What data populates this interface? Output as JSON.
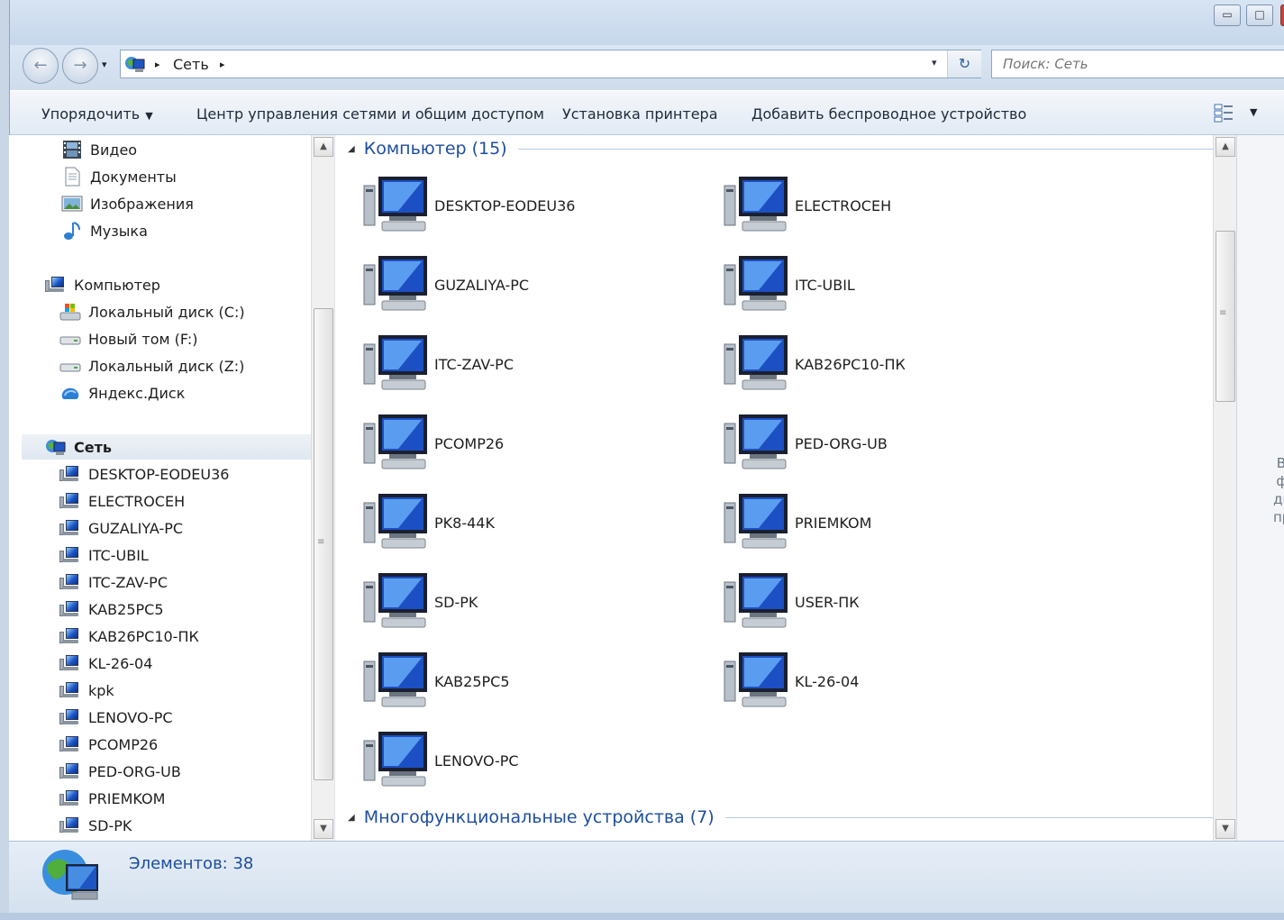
{
  "window": {
    "min_glyph": "▭",
    "max_glyph": "□"
  },
  "address": {
    "back_glyph": "←",
    "forward_glyph": "→",
    "crumb_sep": "▸",
    "crumbs": [
      "Сеть"
    ],
    "dropdown_glyph": "▾",
    "refresh_glyph": "↻"
  },
  "search": {
    "placeholder": "Поиск: Сеть"
  },
  "toolbar": {
    "organize": "Упорядочить",
    "network_center": "Центр управления сетями и общим доступом",
    "add_printer": "Установка принтера",
    "add_wireless": "Добавить беспроводное устройство"
  },
  "nav": {
    "libraries": [
      {
        "label": "Видео",
        "icon": "video-library-icon"
      },
      {
        "label": "Документы",
        "icon": "documents-library-icon"
      },
      {
        "label": "Изображения",
        "icon": "pictures-library-icon"
      },
      {
        "label": "Музыка",
        "icon": "music-library-icon"
      }
    ],
    "computer": {
      "label": "Компьютер"
    },
    "drives": [
      {
        "label": "Локальный диск (C:)",
        "icon": "system-drive-icon"
      },
      {
        "label": "Новый том (F:)",
        "icon": "drive-icon"
      },
      {
        "label": "Локальный диск (Z:)",
        "icon": "drive-icon"
      },
      {
        "label": "Яндекс.Диск",
        "icon": "yandex-disk-icon"
      }
    ],
    "network": {
      "label": "Сеть"
    },
    "hosts": [
      "DESKTOP-EODEU36",
      "ELECTROCEH",
      "GUZALIYA-PC",
      "ITC-UBIL",
      "ITC-ZAV-PC",
      "KAB25PC5",
      "KAB26PC10-ПК",
      "KL-26-04",
      "kpk",
      "LENOVO-PC",
      "PCOMP26",
      "PED-ORG-UB",
      "PRIEMKOM",
      "SD-PK"
    ]
  },
  "content": {
    "group_computers": "Компьютер (15)",
    "group_mfp": "Многофункциональные устройства (7)",
    "computers": [
      "DESKTOP-EODEU36",
      "ELECTROCEH",
      "GUZALIYA-PC",
      "ITC-UBIL",
      "ITC-ZAV-PC",
      "KAB26PC10-ПК",
      "PCOMP26",
      "PED-ORG-UB",
      "PK8-44K",
      "PRIEMKOM",
      "SD-PK",
      "USER-ПК",
      "KAB25PC5",
      "KL-26-04",
      "LENOVO-PC"
    ]
  },
  "preview": {
    "lines": [
      "Выбе",
      "файл",
      "двари",
      "просм"
    ]
  },
  "status": {
    "count": "Элементов: 38"
  },
  "colors": {
    "group_text": "#1e4e9c",
    "window_bg": "#d9e5f2",
    "close_red": "#c8463a"
  }
}
